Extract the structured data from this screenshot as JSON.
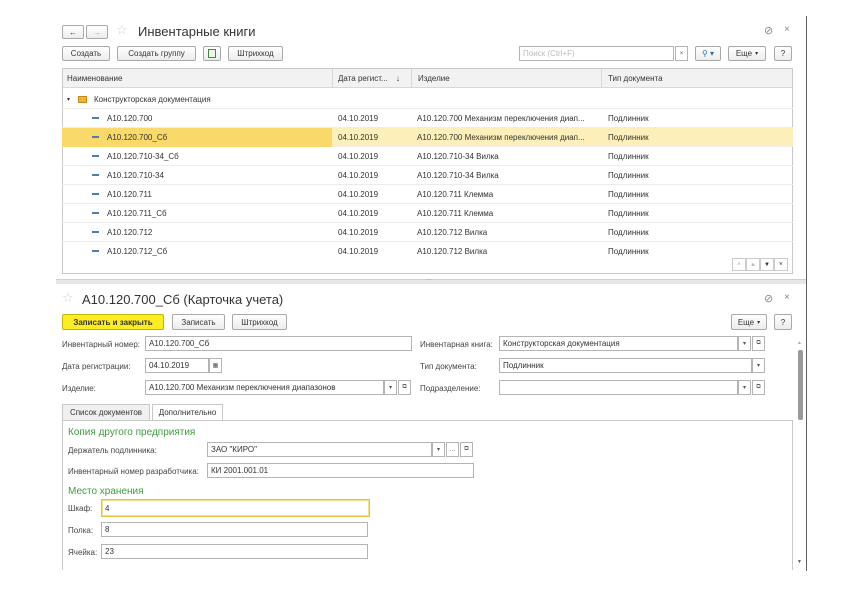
{
  "list": {
    "title": "Инвентарные книги",
    "toolbar": {
      "create": "Создать",
      "create_group": "Создать группу",
      "barcode": "Штрихкод",
      "search_placeholder": "Поиск (Ctrl+F)",
      "more": "Еще",
      "help": "?"
    },
    "columns": [
      "Наименование",
      "Дата регист...",
      "Изделие",
      "Тип документа"
    ],
    "sort_arrow": "↓",
    "group": "Конструкторская документация",
    "rows": [
      {
        "name": "А10.120.700",
        "date": "04.10.2019",
        "product": "А10.120.700 Механизм переключения диап...",
        "type": "Подлинник"
      },
      {
        "name": "А10.120.700_Сб",
        "date": "04.10.2019",
        "product": "А10.120.700 Механизм переключения диап...",
        "type": "Подлинник"
      },
      {
        "name": "А10.120.710-34_Сб",
        "date": "04.10.2019",
        "product": "А10.120.710-34 Вилка",
        "type": "Подлинник"
      },
      {
        "name": "А10.120.710-34",
        "date": "04.10.2019",
        "product": "А10.120.710-34 Вилка",
        "type": "Подлинник"
      },
      {
        "name": "А10.120.711",
        "date": "04.10.2019",
        "product": "А10.120.711 Клемма",
        "type": "Подлинник"
      },
      {
        "name": "А10.120.711_Сб",
        "date": "04.10.2019",
        "product": "А10.120.711 Клемма",
        "type": "Подлинник"
      },
      {
        "name": "А10.120.712",
        "date": "04.10.2019",
        "product": "А10.120.712 Вилка",
        "type": "Подлинник"
      },
      {
        "name": "А10.120.712_Сб",
        "date": "04.10.2019",
        "product": "А10.120.712 Вилка",
        "type": "Подлинник"
      }
    ],
    "splitter": "..."
  },
  "card": {
    "title": "А10.120.700_Сб (Карточка учета)",
    "toolbar": {
      "save_close": "Записать и закрыть",
      "save": "Записать",
      "barcode": "Штрихкод",
      "more": "Еще",
      "help": "?"
    },
    "fields": {
      "inv_num_label": "Инвентарный номер:",
      "inv_num": "А10.120.700_Сб",
      "inv_book_label": "Инвентарная книга:",
      "inv_book": "Конструкторская документация",
      "reg_date_label": "Дата регистрации:",
      "reg_date": "04.10.2019",
      "doc_type_label": "Тип документа:",
      "doc_type": "Подлинник",
      "product_label": "Изделие:",
      "product": "А10.120.700 Механизм переключения диапазонов",
      "division_label": "Подразделение:",
      "division": ""
    },
    "tabs": [
      "Список документов",
      "Дополнительно"
    ],
    "copy_section": {
      "header": "Копия другого предприятия",
      "holder_label": "Держатель подлинника:",
      "holder": "ЗАО \"КИРО\"",
      "dev_num_label": "Инвентарный номер разработчика:",
      "dev_num": "КИ 2001.001.01"
    },
    "storage_section": {
      "header": "Место хранения",
      "cabinet_label": "Шкаф:",
      "cabinet": "4",
      "shelf_label": "Полка:",
      "shelf": "8",
      "cell_label": "Ячейка:",
      "cell": "23"
    }
  }
}
